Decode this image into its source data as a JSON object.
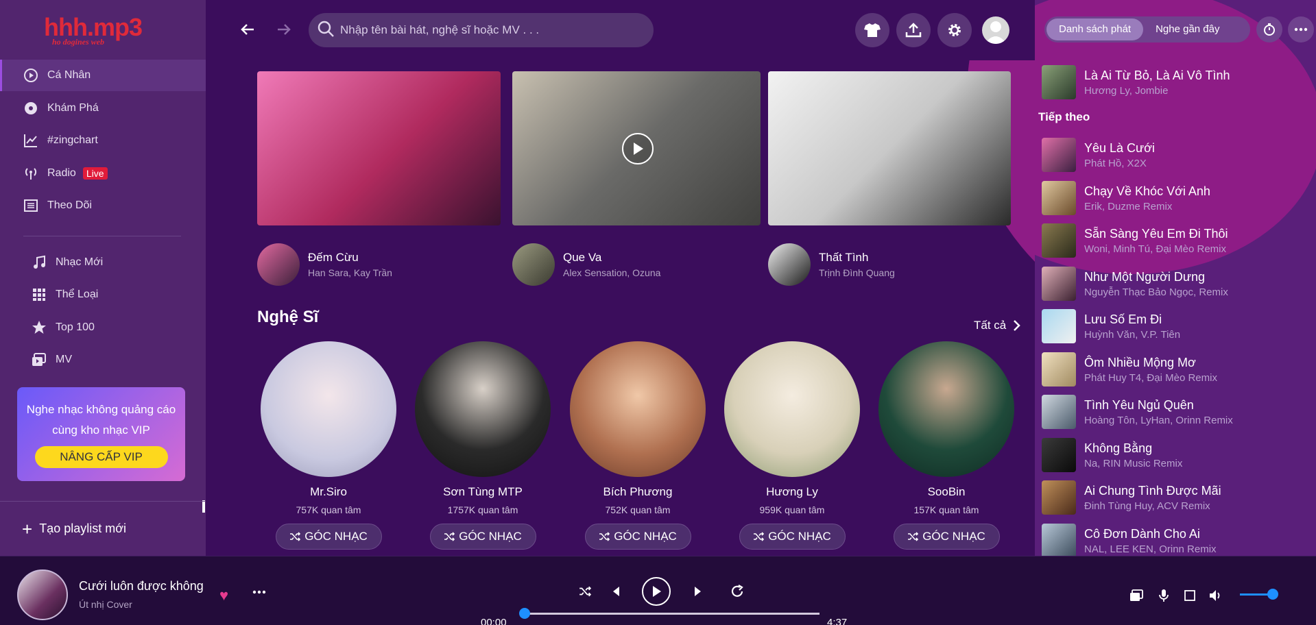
{
  "logo": {
    "main": "hhh.mp3",
    "sub": "ho dogines web"
  },
  "sidebar": {
    "items": [
      {
        "label": "Cá Nhân",
        "icon": "play-circle-icon",
        "active": true
      },
      {
        "label": "Khám Phá",
        "icon": "disc-icon"
      },
      {
        "label": "#zingchart",
        "icon": "chart-line-icon"
      },
      {
        "label": "Radio",
        "icon": "radio-icon",
        "badge": "Live"
      },
      {
        "label": "Theo Dõi",
        "icon": "list-icon"
      }
    ],
    "items2": [
      {
        "label": "Nhạc Mới",
        "icon": "music-note-icon"
      },
      {
        "label": "Thể Loại",
        "icon": "grid-icon"
      },
      {
        "label": "Top 100",
        "icon": "star-icon"
      },
      {
        "label": "MV",
        "icon": "video-icon"
      }
    ],
    "vip": {
      "text1": "Nghe nhạc không quảng cáo",
      "text2": "cùng kho nhạc VIP",
      "button": "NÂNG CẤP VIP"
    },
    "new_playlist": "Tạo playlist mới"
  },
  "search": {
    "placeholder": "Nhập tên bài hát, nghệ sĩ hoặc MV . . ."
  },
  "releases": [
    {
      "title": "Đếm Cừu",
      "artists": "Han Sara, Kay Trần"
    },
    {
      "title": "Que Va",
      "artists": "Alex Sensation, Ozuna"
    },
    {
      "title": "Thất Tình",
      "artists": "Trịnh Đình Quang"
    }
  ],
  "artists_section": {
    "title": "Nghệ Sĩ",
    "see_all": "Tất cả",
    "button_label": "GÓC NHẠC",
    "artists": [
      {
        "name": "Mr.Siro",
        "fans": "757K quan tâm"
      },
      {
        "name": "Sơn Tùng MTP",
        "fans": "1757K quan tâm"
      },
      {
        "name": "Bích Phương",
        "fans": "752K quan tâm"
      },
      {
        "name": "Hương Ly",
        "fans": "959K quan tâm"
      },
      {
        "name": "SooBin",
        "fans": "157K quan tâm"
      }
    ]
  },
  "right_panel": {
    "tabs": [
      "Danh sách phát",
      "Nghe gần đây"
    ],
    "current": {
      "title": "Là Ai Từ Bỏ, Là Ai Vô Tình",
      "artist": "Hương Ly, Jombie"
    },
    "next_label": "Tiếp theo",
    "queue": [
      {
        "title": "Yêu Là Cưới",
        "artist": "Phát Hồ, X2X"
      },
      {
        "title": "Chạy Về Khóc Với Anh",
        "artist": "Erik, Duzme Remix"
      },
      {
        "title": "Sẵn Sàng Yêu Em Đi Thôi",
        "artist": "Woni, Minh Tú, Đại Mèo Remix"
      },
      {
        "title": "Như Một Người Dưng",
        "artist": "Nguyễn Thạc Bảo Ngọc, Remix"
      },
      {
        "title": "Lưu Số Em Đi",
        "artist": "Huỳnh Văn, V.P. Tiên"
      },
      {
        "title": "Ôm Nhiều Mộng Mơ",
        "artist": "Phát Huy T4, Đại Mèo Remix"
      },
      {
        "title": "Tình Yêu Ngủ Quên",
        "artist": "Hoàng Tôn, LyHan, Orinn Remix"
      },
      {
        "title": "Không Bằng",
        "artist": "Na, RIN Music Remix"
      },
      {
        "title": "Ai Chung Tình Được Mãi",
        "artist": "Đinh Tùng Huy, ACV Remix"
      },
      {
        "title": "Cô Đơn Dành Cho Ai",
        "artist": "NAL, LEE KEN, Orinn Remix"
      }
    ]
  },
  "player": {
    "title": "Cưới luôn được không",
    "artist": "Út nhị Cover",
    "time_current": "00:00",
    "time_total": "4:37",
    "progress": 0,
    "volume": 0.8
  },
  "colors": {
    "accent": "#9b4de0",
    "vip_button": "#fdd81d",
    "live": "#e01b3a",
    "heart": "#e73a8f",
    "slider": "#1e90ff"
  }
}
